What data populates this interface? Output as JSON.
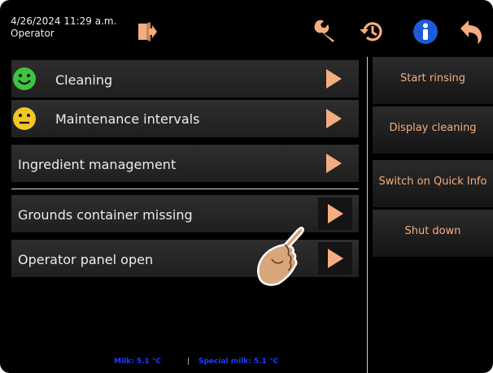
{
  "header": {
    "datetime": "4/26/2024 11:29 a.m.",
    "user_role": "Operator",
    "icons": [
      "logout-icon",
      "wrench-icon",
      "history-icon",
      "info-icon",
      "back-icon"
    ]
  },
  "menu": {
    "items": [
      {
        "label": "Cleaning",
        "status_icon": "smiley-happy-icon"
      },
      {
        "label": "Maintenance intervals",
        "status_icon": "smiley-neutral-icon"
      },
      {
        "label": "Ingredient management"
      }
    ],
    "messages": [
      {
        "label": "Grounds container missing"
      },
      {
        "label": "Operator panel open"
      }
    ]
  },
  "side_buttons": {
    "start_rinsing": "Start rinsing",
    "display_cleaning": "Display cleaning",
    "quick_info": "Switch on Quick Info",
    "shut_down": "Shut down"
  },
  "status": {
    "milk": "Milk: 5.1 °C",
    "separator": "|",
    "special_milk": "Special milk: 5.1 °C"
  },
  "colors": {
    "accent_orange": "#f4ad80",
    "status_blue": "#1f3cff",
    "info_blue": "#1e5bd6",
    "smiley_green": "#3ec43e",
    "smiley_yellow": "#f3c623"
  }
}
